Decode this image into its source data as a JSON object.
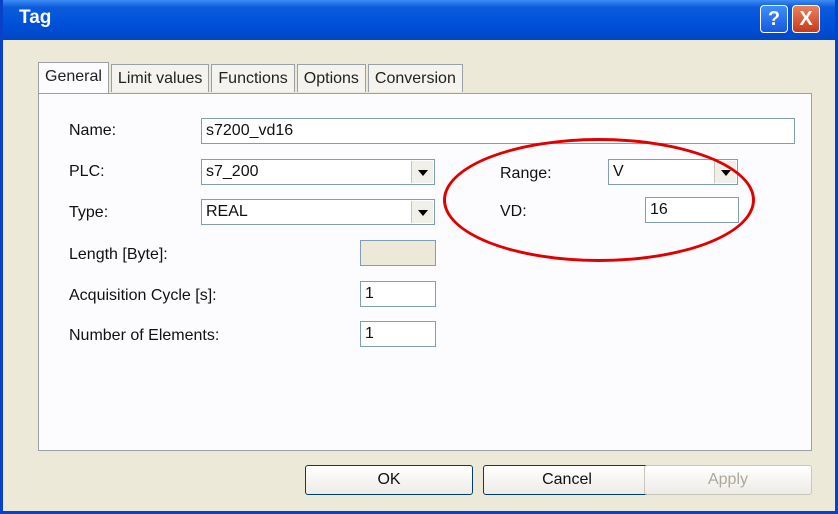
{
  "window": {
    "title": "Tag",
    "help_label": "?",
    "close_label": "X"
  },
  "tabs": [
    {
      "label": "General",
      "active": true
    },
    {
      "label": "Limit values",
      "active": false
    },
    {
      "label": "Functions",
      "active": false
    },
    {
      "label": "Options",
      "active": false
    },
    {
      "label": "Conversion",
      "active": false
    }
  ],
  "form": {
    "name_label": "Name:",
    "name_value": "s7200_vd16",
    "plc_label": "PLC:",
    "plc_value": "s7_200",
    "type_label": "Type:",
    "type_value": "REAL",
    "length_label": "Length [Byte]:",
    "length_value": "",
    "cycle_label": "Acquisition Cycle [s]:",
    "cycle_value": "1",
    "elements_label": "Number of Elements:",
    "elements_value": "1",
    "range_label": "Range:",
    "range_value": "V",
    "vd_label": "VD:",
    "vd_value": "16"
  },
  "buttons": {
    "ok": "OK",
    "cancel": "Cancel",
    "apply": "Apply"
  },
  "annotation": {
    "color": "#e00000"
  }
}
